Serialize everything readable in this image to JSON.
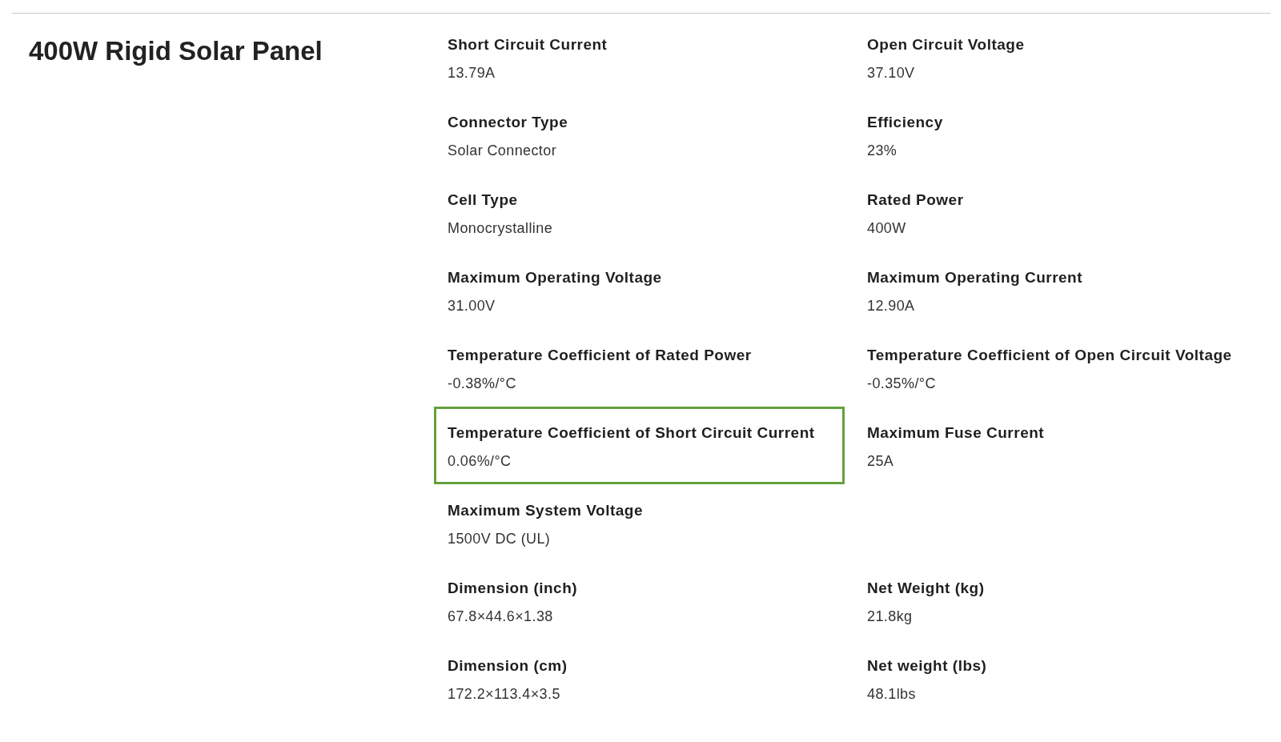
{
  "title": "400W Rigid Solar Panel",
  "rows": [
    {
      "cells": [
        {
          "label": "Short Circuit Current",
          "value": "13.79A",
          "highlighted": false
        },
        {
          "label": "Open Circuit Voltage",
          "value": "37.10V",
          "highlighted": false
        }
      ]
    },
    {
      "cells": [
        {
          "label": "Connector Type",
          "value": "Solar Connector",
          "highlighted": false
        },
        {
          "label": "Efficiency",
          "value": "23%",
          "highlighted": false
        }
      ]
    },
    {
      "cells": [
        {
          "label": "Cell Type",
          "value": "Monocrystalline",
          "highlighted": false
        },
        {
          "label": "Rated Power",
          "value": "400W",
          "highlighted": false
        }
      ]
    },
    {
      "cells": [
        {
          "label": "Maximum Operating Voltage",
          "value": "31.00V",
          "highlighted": false
        },
        {
          "label": "Maximum Operating Current",
          "value": "12.90A",
          "highlighted": false
        }
      ]
    },
    {
      "cells": [
        {
          "label": "Temperature Coefficient of Rated Power",
          "value": "-0.38%/°C",
          "highlighted": false
        },
        {
          "label": "Temperature Coefficient of Open Circuit Voltage",
          "value": "-0.35%/°C",
          "highlighted": false
        }
      ]
    },
    {
      "cells": [
        {
          "label": "Temperature Coefficient of Short Circuit Current",
          "value": "0.06%/°C",
          "highlighted": true
        },
        {
          "label": "Maximum Fuse Current",
          "value": "25A",
          "highlighted": false
        }
      ]
    },
    {
      "cells": [
        {
          "label": "Maximum System Voltage",
          "value": "1500V DC (UL)",
          "highlighted": false
        }
      ]
    },
    {
      "cells": [
        {
          "label": "Dimension (inch)",
          "value": "67.8×44.6×1.38",
          "highlighted": false
        },
        {
          "label": "Net Weight (kg)",
          "value": "21.8kg",
          "highlighted": false
        }
      ]
    },
    {
      "cells": [
        {
          "label": "Dimension (cm)",
          "value": "172.2×113.4×3.5",
          "highlighted": false
        },
        {
          "label": "Net weight (lbs)",
          "value": "48.1lbs",
          "highlighted": false
        }
      ]
    }
  ]
}
